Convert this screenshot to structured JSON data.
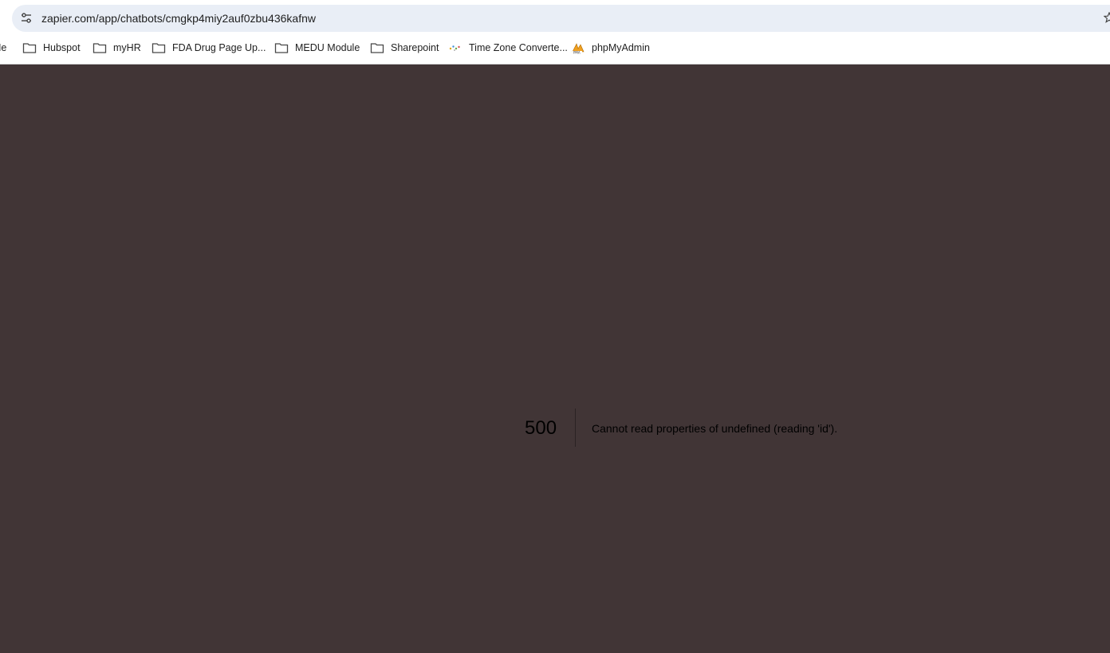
{
  "browser": {
    "url": "zapier.com/app/chatbots/cmgkp4miy2auf0zbu436kafnw",
    "site_info_icon": "tune-icon",
    "bookmark_star_icon": "star-icon",
    "bookmarks": [
      {
        "label": "Me",
        "icon": "none"
      },
      {
        "label": "Hubspot",
        "icon": "folder-icon"
      },
      {
        "label": "myHR",
        "icon": "folder-icon"
      },
      {
        "label": "FDA Drug Page Up...",
        "icon": "folder-icon"
      },
      {
        "label": "MEDU Module",
        "icon": "folder-icon"
      },
      {
        "label": "Sharepoint",
        "icon": "folder-icon"
      },
      {
        "label": "Time Zone Converte...",
        "icon": "time-zone-favicon"
      },
      {
        "label": "phpMyAdmin",
        "icon": "phpmyadmin-favicon"
      }
    ]
  },
  "error": {
    "code": "500",
    "message": "Cannot read properties of undefined (reading 'id')."
  },
  "colors": {
    "page_background": "#413536",
    "chrome_background": "#ffffff",
    "address_bar": "#e9eef6",
    "text": "#000000"
  }
}
